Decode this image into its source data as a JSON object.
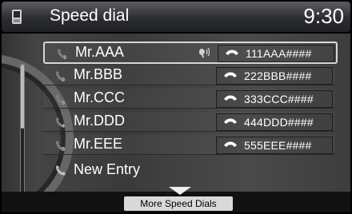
{
  "header": {
    "title": "Speed dial",
    "time": "9:30"
  },
  "entries": [
    {
      "name": "Mr.AAA",
      "number": "111AAA####",
      "index": 1,
      "voice_tag": true,
      "selected": true
    },
    {
      "name": "Mr.BBB",
      "number": "222BBB####",
      "index": 2,
      "voice_tag": false,
      "selected": false
    },
    {
      "name": "Mr.CCC",
      "number": "333CCC####",
      "index": 3,
      "voice_tag": false,
      "selected": false
    },
    {
      "name": "Mr.DDD",
      "number": "444DDD####",
      "index": 4,
      "voice_tag": false,
      "selected": false
    },
    {
      "name": "Mr.EEE",
      "number": "555EEE####",
      "index": 5,
      "voice_tag": false,
      "selected": false
    }
  ],
  "new_entry_label": "New Entry",
  "footer": {
    "more_label": "More Speed Dials"
  },
  "icons": {
    "phone": "phone-device-icon",
    "handset": "handset-icon",
    "voice_tag": "voice-tag-icon",
    "scroll_down": "chevron-down-icon"
  },
  "colors": {
    "text": "#ffffff",
    "background": "#000000",
    "button": "#d9d9d9"
  }
}
